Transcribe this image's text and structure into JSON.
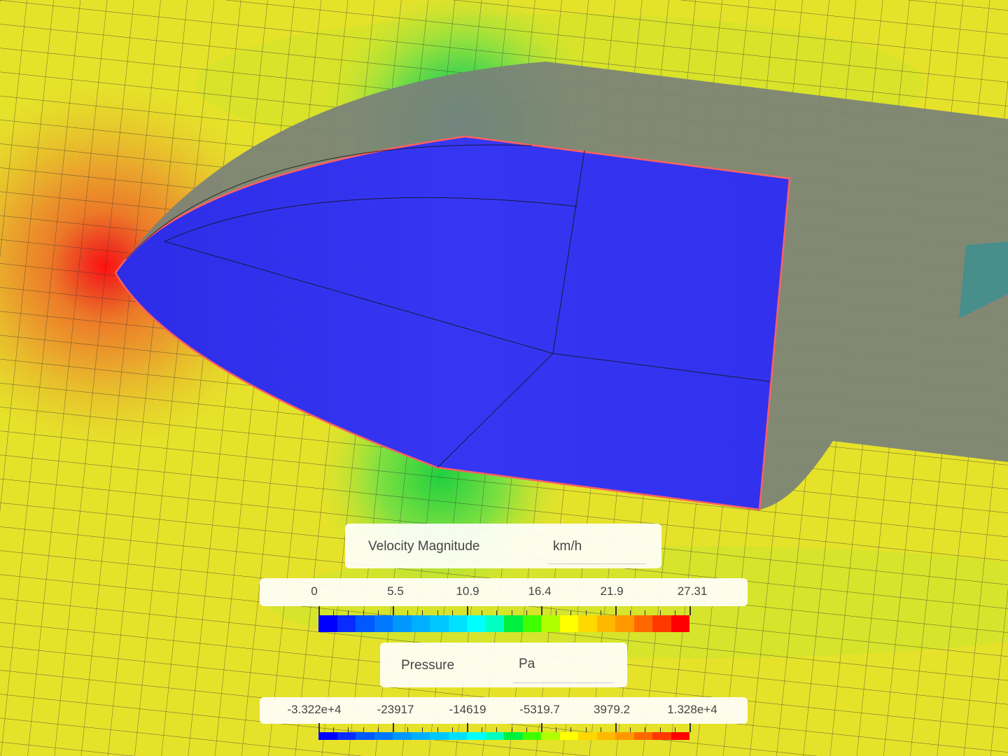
{
  "legends": [
    {
      "title": "Velocity Magnitude",
      "unit": "km/h",
      "ticks": [
        "0",
        "5.5",
        "10.9",
        "16.4",
        "21.9",
        "27.31"
      ]
    },
    {
      "title": "Pressure",
      "unit": "Pa",
      "ticks": [
        "-3.322e+4",
        "-23917",
        "-14619",
        "-5319.7",
        "3979.2",
        "1.328e+4"
      ]
    }
  ],
  "colormap": [
    "#0000ff",
    "#0a2bff",
    "#0058ff",
    "#0078ff",
    "#0098ff",
    "#00b0ff",
    "#00c8ff",
    "#00e0ff",
    "#00ffff",
    "#00ffc0",
    "#00f040",
    "#40ff00",
    "#b0ff00",
    "#ffff00",
    "#ffd800",
    "#ffb800",
    "#ff9800",
    "#ff6800",
    "#ff3800",
    "#ff0000"
  ],
  "colors": {
    "field": "#e6e22a",
    "body": "#3030ee",
    "shell": "#7a8278"
  }
}
